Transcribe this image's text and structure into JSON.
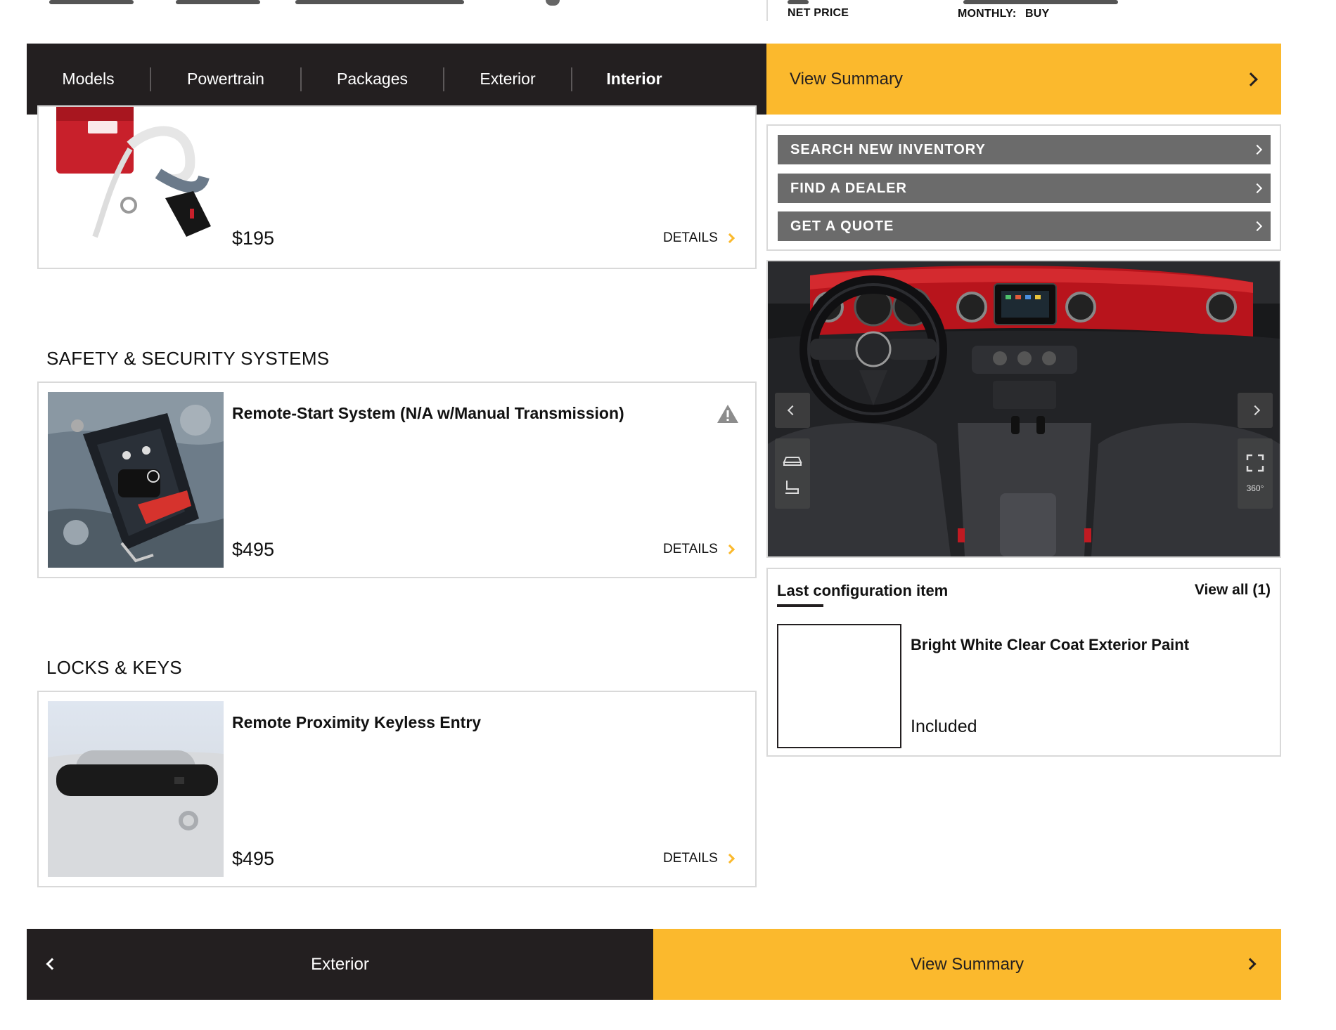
{
  "header": {
    "net_price_label": "NET PRICE",
    "monthly_label": "MONTHLY:",
    "buy_label": "BUY"
  },
  "nav": {
    "tabs": [
      {
        "label": "Models"
      },
      {
        "label": "Powertrain"
      },
      {
        "label": "Packages"
      },
      {
        "label": "Exterior"
      },
      {
        "label": "Interior"
      }
    ],
    "active_tab": "Interior",
    "summary_label": "View Summary"
  },
  "main": {
    "top_card": {
      "price": "$195",
      "details_label": "DETAILS"
    },
    "sections": [
      {
        "title": "SAFETY & SECURITY SYSTEMS",
        "item": {
          "title": "Remote-Start System (N/A w/Manual Transmission)",
          "price": "$495",
          "details_label": "DETAILS",
          "warning_icon": "warning-icon"
        }
      },
      {
        "title": "LOCKS & KEYS",
        "item": {
          "title": "Remote Proximity Keyless Entry",
          "price": "$495",
          "details_label": "DETAILS"
        }
      }
    ]
  },
  "sidebar": {
    "actions": [
      {
        "label": "SEARCH NEW INVENTORY"
      },
      {
        "label": "FIND A DEALER"
      },
      {
        "label": "GET A QUOTE"
      }
    ],
    "viewer": {
      "icons": [
        "chevron-left-icon",
        "chevron-right-icon",
        "car-view-icon",
        "seat-view-icon",
        "fullscreen-icon",
        "rotate-360-icon"
      ],
      "label_360": "360°"
    },
    "last_config": {
      "title": "Last configuration item",
      "view_all_label": "View all (1)",
      "item_name": "Bright White Clear Coat Exterior Paint",
      "item_status": "Included"
    }
  },
  "footer": {
    "prev_label": "Exterior",
    "next_label": "View Summary"
  },
  "colors": {
    "accent": "#fbb92d",
    "dark": "#231f20",
    "action_gray": "#6b6b6b",
    "border": "#d9d9d9"
  }
}
